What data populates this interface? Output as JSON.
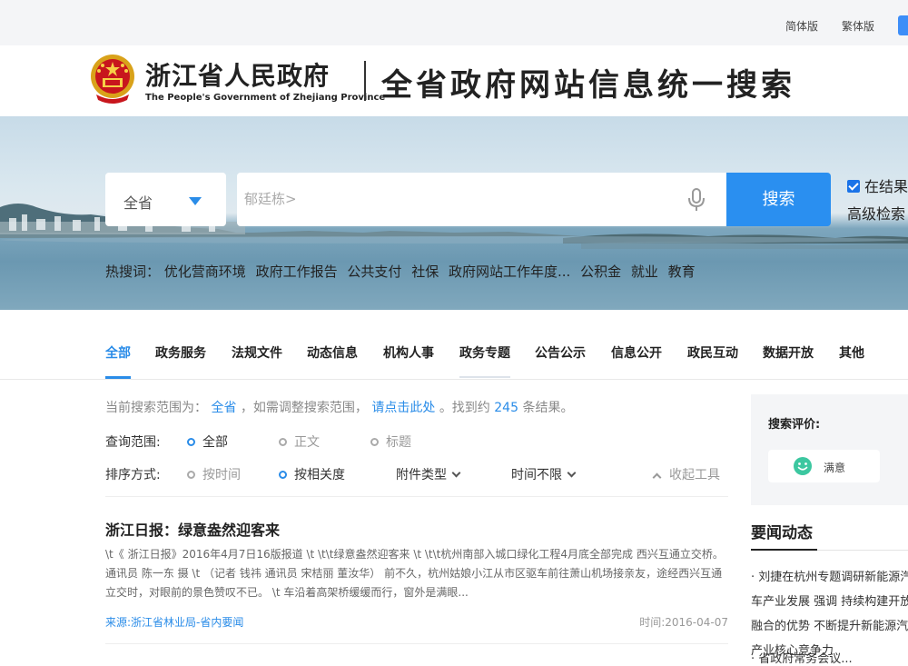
{
  "topbar": {
    "simplified": "简体版",
    "traditional": "繁体版"
  },
  "header": {
    "gov_name": "浙江省人民政府",
    "gov_name_en": "The People's Government of Zhejiang Province",
    "site_title": "全省政府网站信息统一搜索"
  },
  "search": {
    "scope": "全省",
    "placeholder": "郁廷栋>",
    "button": "搜索",
    "in_results": "在结果",
    "advanced": "高级检索"
  },
  "hot": {
    "label": "热搜词：",
    "items": [
      "优化营商环境",
      "政府工作报告",
      "公共支付",
      "社保",
      "政府网站工作年度...",
      "公积金",
      "就业",
      "教育"
    ]
  },
  "tabs": [
    "全部",
    "政务服务",
    "法规文件",
    "动态信息",
    "机构人事",
    "政务专题",
    "公告公示",
    "信息公开",
    "政民互动",
    "数据开放",
    "其他"
  ],
  "scope_line": {
    "prefix": "当前搜索范围为：",
    "scope": "全省",
    "mid": "，如需调整搜索范围，",
    "link": "请点击此处",
    "found": "。找到约",
    "count": "245",
    "suffix": "条结果。"
  },
  "filters": {
    "range_label": "查询范围:",
    "range_options": [
      "全部",
      "正文",
      "标题"
    ],
    "sort_label": "排序方式:",
    "sort_options": [
      "按时间",
      "按相关度"
    ],
    "attachment": "附件类型",
    "time": "时间不限",
    "collapse": "收起工具"
  },
  "result": {
    "title": "浙江日报：绿意盎然迎客来",
    "snippet": "\\t《 浙江日报》2016年4月7日16版报道 \\t \\t\\t绿意盎然迎客来 \\t \\t\\t杭州南部入城口绿化工程4月底全部完成 西兴互通立交桥。 通讯员 陈一东 摄 \\t （记者 钱祎 通讯员 宋桔丽 董汝华） 前不久，杭州姑娘小江从市区驱车前往萧山机场接亲友，途经西兴互通立交时，对眼前的景色赞叹不已。 \\t 车沿着高架桥缓缓而行，窗外是满眼...",
    "source": "来源:浙江省林业局-省内要闻",
    "time": "时间:2016-04-07"
  },
  "rating": {
    "title": "搜索评价:",
    "satisfied": "满意"
  },
  "news": {
    "heading": "要闻动态",
    "item1": "· 刘捷在杭州专题调研新能源汽车产业发展 强调 持续构建开放融合的优势 不断提升新能源汽车产业核心竞争力",
    "item2": "· 省政府常务会议..."
  },
  "colors": {
    "accent": "#2a8ce8",
    "search_button": "#2a8ff0"
  }
}
